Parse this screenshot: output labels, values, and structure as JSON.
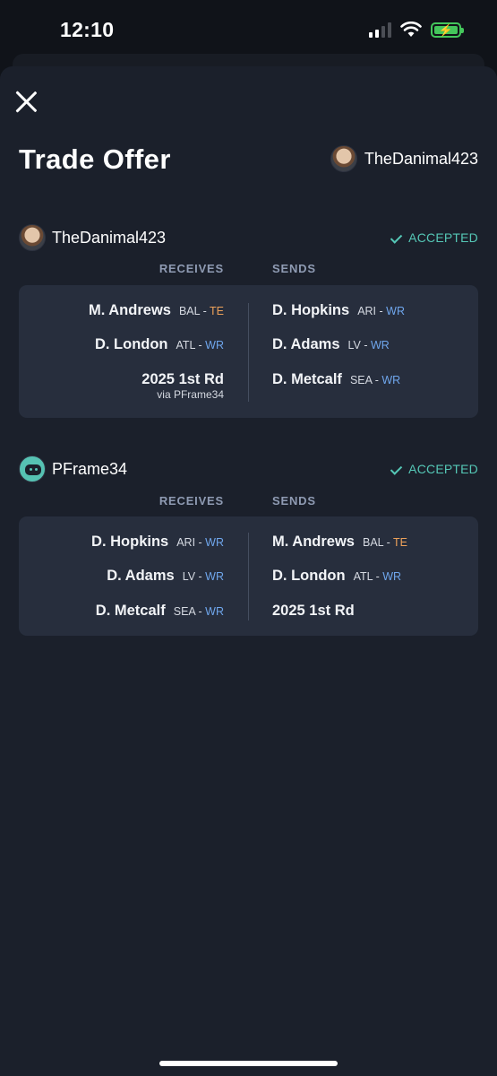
{
  "status": {
    "time": "12:10"
  },
  "header": {
    "title": "Trade Offer",
    "user": "TheDanimal423"
  },
  "parties": [
    {
      "user": "TheDanimal423",
      "status": "ACCEPTED",
      "receives_label": "RECEIVES",
      "sends_label": "SENDS",
      "receives": [
        {
          "name": "M. Andrews",
          "team": "BAL",
          "sep": " - ",
          "pos": "TE",
          "pos_class": "te"
        },
        {
          "name": "D. London",
          "team": "ATL",
          "sep": " - ",
          "pos": "WR",
          "pos_class": "wr"
        },
        {
          "name": "2025 1st Rd",
          "team": "",
          "sep": "",
          "pos": "",
          "pos_class": "",
          "via": "via PFrame34"
        }
      ],
      "sends": [
        {
          "name": "D. Hopkins",
          "team": "ARI",
          "sep": " - ",
          "pos": "WR",
          "pos_class": "wr"
        },
        {
          "name": "D. Adams",
          "team": "LV",
          "sep": " - ",
          "pos": "WR",
          "pos_class": "wr"
        },
        {
          "name": "D. Metcalf",
          "team": "SEA",
          "sep": " - ",
          "pos": "WR",
          "pos_class": "wr"
        }
      ]
    },
    {
      "user": "PFrame34",
      "status": "ACCEPTED",
      "receives_label": "RECEIVES",
      "sends_label": "SENDS",
      "receives": [
        {
          "name": "D. Hopkins",
          "team": "ARI",
          "sep": " - ",
          "pos": "WR",
          "pos_class": "wr"
        },
        {
          "name": "D. Adams",
          "team": "LV",
          "sep": " - ",
          "pos": "WR",
          "pos_class": "wr"
        },
        {
          "name": "D. Metcalf",
          "team": "SEA",
          "sep": " - ",
          "pos": "WR",
          "pos_class": "wr"
        }
      ],
      "sends": [
        {
          "name": "M. Andrews",
          "team": "BAL",
          "sep": " - ",
          "pos": "TE",
          "pos_class": "te"
        },
        {
          "name": "D. London",
          "team": "ATL",
          "sep": " - ",
          "pos": "WR",
          "pos_class": "wr"
        },
        {
          "name": "2025 1st Rd",
          "team": "",
          "sep": "",
          "pos": "",
          "pos_class": ""
        }
      ]
    }
  ],
  "icons": [
    "close-icon",
    "check-icon",
    "signal-icon",
    "wifi-icon",
    "battery-icon"
  ],
  "colors": {
    "accepted": "#55c7b6",
    "te": "#eca15a",
    "wr": "#6fa6ec",
    "card": "#272e3d",
    "sheet": "#1b202b"
  }
}
